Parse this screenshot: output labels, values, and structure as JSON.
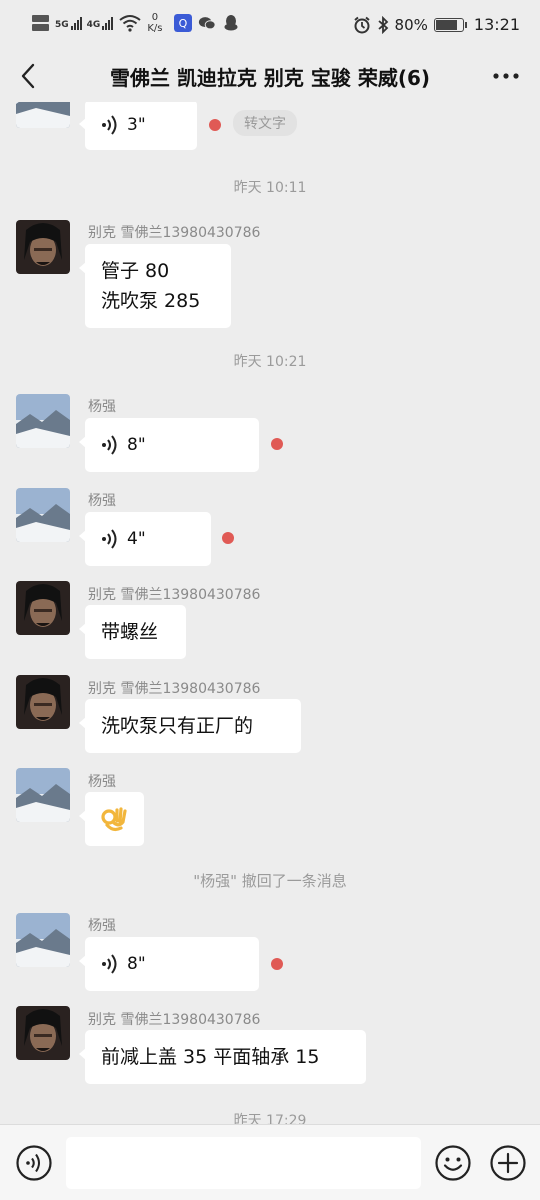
{
  "status_bar": {
    "net_speed_value": "0",
    "net_speed_unit": "K/s",
    "net_label_1": "5G",
    "net_label_2": "4G",
    "battery_percent": "80%",
    "battery_level": 0.8,
    "time": "13:21",
    "icons": [
      "hd-icon",
      "signal-icon",
      "wifi-icon",
      "qq-browser-icon",
      "wechat-icon",
      "qq-icon",
      "alarm-icon",
      "bluetooth-icon",
      "battery-icon"
    ]
  },
  "header": {
    "title": "雪佛兰 凯迪拉克 别克 宝骏 荣威(6)",
    "icons": [
      "back-arrow-icon",
      "more-dots-icon"
    ]
  },
  "messages": [
    {
      "type": "voice",
      "duration": "3\"",
      "unread": true,
      "action_label": "转文字"
    },
    {
      "type": "time",
      "text": "昨天 10:11"
    },
    {
      "type": "text",
      "sender": "别克 雪佛兰13980430786",
      "lines": [
        "管子 80",
        "洗吹泵 285"
      ]
    },
    {
      "type": "time",
      "text": "昨天 10:21"
    },
    {
      "type": "voice",
      "sender": "杨强",
      "duration": "8\"",
      "unread": true
    },
    {
      "type": "voice",
      "sender": "杨强",
      "duration": "4\"",
      "unread": true
    },
    {
      "type": "text",
      "sender": "别克 雪佛兰13980430786",
      "lines": [
        "带螺丝"
      ]
    },
    {
      "type": "text",
      "sender": "别克 雪佛兰13980430786",
      "lines": [
        "洗吹泵只有正厂的"
      ]
    },
    {
      "type": "emoji",
      "sender": "杨强",
      "emoji": "👌"
    },
    {
      "type": "recall",
      "text": "\"杨强\" 撤回了一条消息"
    },
    {
      "type": "voice",
      "sender": "杨强",
      "duration": "8\"",
      "unread": true
    },
    {
      "type": "text",
      "sender": "别克 雪佛兰13980430786",
      "lines": [
        "前减上盖 35 平面轴承 15"
      ]
    },
    {
      "type": "time",
      "text": "昨天 17:29"
    }
  ],
  "input_bar": {
    "value": "",
    "icons": [
      "voice-mode-icon",
      "emoji-icon",
      "plus-icon"
    ]
  },
  "colors": {
    "background": "#ededed",
    "bubble": "#ffffff",
    "unread_dot": "#e05a55",
    "meta_text": "#9b9b9b"
  }
}
